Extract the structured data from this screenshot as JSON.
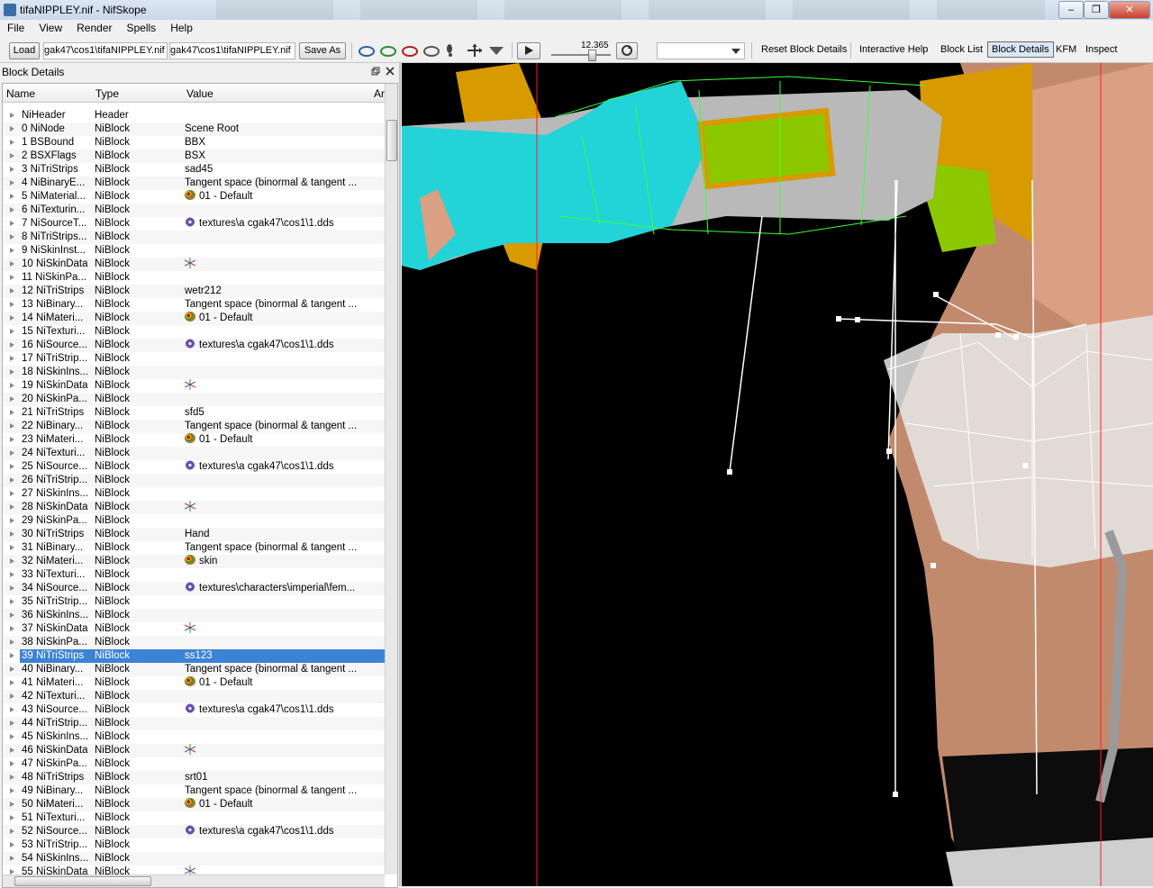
{
  "window": {
    "title": "tifaNIPPLEY.nif - NifSkope",
    "minimize": "–",
    "maximize": "❐",
    "close": "✕"
  },
  "menu": [
    "File",
    "View",
    "Render",
    "Spells",
    "Help"
  ],
  "toolbar": {
    "load_label": "Load",
    "load_path": "gak47\\cos1\\tifaNIPPLEY.nif",
    "save_path": "gak47\\cos1\\tifaNIPPLEY.nif",
    "save_as_label": "Save As",
    "time_value": "12.365",
    "reset_block_details": "Reset Block Details",
    "interactive_help": "Interactive Help",
    "block_list": "Block List",
    "block_details": "Block Details",
    "kfm": "KFM",
    "inspect": "Inspect"
  },
  "dock": {
    "title": "Block Details"
  },
  "table": {
    "headers": [
      "Name",
      "Type",
      "Value",
      "Ar"
    ],
    "rows": [
      {
        "name": "NiHeader",
        "type": "Header",
        "value": "",
        "icon": ""
      },
      {
        "name": "0 NiNode",
        "type": "NiBlock",
        "value": "Scene Root",
        "icon": ""
      },
      {
        "name": "1 BSBound",
        "type": "NiBlock",
        "value": "BBX",
        "icon": ""
      },
      {
        "name": "2 BSXFlags",
        "type": "NiBlock",
        "value": "BSX",
        "icon": ""
      },
      {
        "name": "3 NiTriStrips",
        "type": "NiBlock",
        "value": "sad45",
        "icon": ""
      },
      {
        "name": "4 NiBinaryE...",
        "type": "NiBlock",
        "value": "Tangent space (binormal & tangent ...",
        "icon": ""
      },
      {
        "name": "5 NiMaterial...",
        "type": "NiBlock",
        "value": "01 - Default",
        "icon": "palette"
      },
      {
        "name": "6 NiTexturin...",
        "type": "NiBlock",
        "value": "",
        "icon": ""
      },
      {
        "name": "7 NiSourceT...",
        "type": "NiBlock",
        "value": "textures\\a cgak47\\cos1\\1.dds",
        "icon": "tex"
      },
      {
        "name": "8 NiTriStrips...",
        "type": "NiBlock",
        "value": "",
        "icon": ""
      },
      {
        "name": "9 NiSkinInst...",
        "type": "NiBlock",
        "value": "",
        "icon": ""
      },
      {
        "name": "10 NiSkinData",
        "type": "NiBlock",
        "value": "",
        "icon": "skin"
      },
      {
        "name": "11 NiSkinPa...",
        "type": "NiBlock",
        "value": "",
        "icon": ""
      },
      {
        "name": "12 NiTriStrips",
        "type": "NiBlock",
        "value": "wetr212",
        "icon": ""
      },
      {
        "name": "13 NiBinary...",
        "type": "NiBlock",
        "value": "Tangent space (binormal & tangent ...",
        "icon": ""
      },
      {
        "name": "14 NiMateri...",
        "type": "NiBlock",
        "value": "01 - Default",
        "icon": "palette"
      },
      {
        "name": "15 NiTexturi...",
        "type": "NiBlock",
        "value": "",
        "icon": ""
      },
      {
        "name": "16 NiSource...",
        "type": "NiBlock",
        "value": "textures\\a cgak47\\cos1\\1.dds",
        "icon": "tex"
      },
      {
        "name": "17 NiTriStrip...",
        "type": "NiBlock",
        "value": "",
        "icon": ""
      },
      {
        "name": "18 NiSkinIns...",
        "type": "NiBlock",
        "value": "",
        "icon": ""
      },
      {
        "name": "19 NiSkinData",
        "type": "NiBlock",
        "value": "",
        "icon": "skin"
      },
      {
        "name": "20 NiSkinPa...",
        "type": "NiBlock",
        "value": "",
        "icon": ""
      },
      {
        "name": "21 NiTriStrips",
        "type": "NiBlock",
        "value": "sfd5",
        "icon": ""
      },
      {
        "name": "22 NiBinary...",
        "type": "NiBlock",
        "value": "Tangent space (binormal & tangent ...",
        "icon": ""
      },
      {
        "name": "23 NiMateri...",
        "type": "NiBlock",
        "value": "01 - Default",
        "icon": "palette"
      },
      {
        "name": "24 NiTexturi...",
        "type": "NiBlock",
        "value": "",
        "icon": ""
      },
      {
        "name": "25 NiSource...",
        "type": "NiBlock",
        "value": "textures\\a cgak47\\cos1\\1.dds",
        "icon": "tex"
      },
      {
        "name": "26 NiTriStrip...",
        "type": "NiBlock",
        "value": "",
        "icon": ""
      },
      {
        "name": "27 NiSkinIns...",
        "type": "NiBlock",
        "value": "",
        "icon": ""
      },
      {
        "name": "28 NiSkinData",
        "type": "NiBlock",
        "value": "",
        "icon": "skin"
      },
      {
        "name": "29 NiSkinPa...",
        "type": "NiBlock",
        "value": "",
        "icon": ""
      },
      {
        "name": "30 NiTriStrips",
        "type": "NiBlock",
        "value": "Hand",
        "icon": ""
      },
      {
        "name": "31 NiBinary...",
        "type": "NiBlock",
        "value": "Tangent space (binormal & tangent ...",
        "icon": ""
      },
      {
        "name": "32 NiMateri...",
        "type": "NiBlock",
        "value": "skin",
        "icon": "palette"
      },
      {
        "name": "33 NiTexturi...",
        "type": "NiBlock",
        "value": "",
        "icon": ""
      },
      {
        "name": "34 NiSource...",
        "type": "NiBlock",
        "value": "textures\\characters\\imperial\\fem...",
        "icon": "tex"
      },
      {
        "name": "35 NiTriStrip...",
        "type": "NiBlock",
        "value": "",
        "icon": ""
      },
      {
        "name": "36 NiSkinIns...",
        "type": "NiBlock",
        "value": "",
        "icon": ""
      },
      {
        "name": "37 NiSkinData",
        "type": "NiBlock",
        "value": "",
        "icon": "skin"
      },
      {
        "name": "38 NiSkinPa...",
        "type": "NiBlock",
        "value": "",
        "icon": ""
      },
      {
        "name": "39 NiTriStrips",
        "type": "NiBlock",
        "value": "ss123",
        "icon": "",
        "selected": true
      },
      {
        "name": "40 NiBinary...",
        "type": "NiBlock",
        "value": "Tangent space (binormal & tangent ...",
        "icon": ""
      },
      {
        "name": "41 NiMateri...",
        "type": "NiBlock",
        "value": "01 - Default",
        "icon": "palette"
      },
      {
        "name": "42 NiTexturi...",
        "type": "NiBlock",
        "value": "",
        "icon": ""
      },
      {
        "name": "43 NiSource...",
        "type": "NiBlock",
        "value": "textures\\a cgak47\\cos1\\1.dds",
        "icon": "tex"
      },
      {
        "name": "44 NiTriStrip...",
        "type": "NiBlock",
        "value": "",
        "icon": ""
      },
      {
        "name": "45 NiSkinIns...",
        "type": "NiBlock",
        "value": "",
        "icon": ""
      },
      {
        "name": "46 NiSkinData",
        "type": "NiBlock",
        "value": "",
        "icon": "skin"
      },
      {
        "name": "47 NiSkinPa...",
        "type": "NiBlock",
        "value": "",
        "icon": ""
      },
      {
        "name": "48 NiTriStrips",
        "type": "NiBlock",
        "value": "srt01",
        "icon": ""
      },
      {
        "name": "49 NiBinary...",
        "type": "NiBlock",
        "value": "Tangent space (binormal & tangent ...",
        "icon": ""
      },
      {
        "name": "50 NiMateri...",
        "type": "NiBlock",
        "value": "01 - Default",
        "icon": "palette"
      },
      {
        "name": "51 NiTexturi...",
        "type": "NiBlock",
        "value": "",
        "icon": ""
      },
      {
        "name": "52 NiSource...",
        "type": "NiBlock",
        "value": "textures\\a cgak47\\cos1\\1.dds",
        "icon": "tex"
      },
      {
        "name": "53 NiTriStrip...",
        "type": "NiBlock",
        "value": "",
        "icon": ""
      },
      {
        "name": "54 NiSkinIns...",
        "type": "NiBlock",
        "value": "",
        "icon": ""
      },
      {
        "name": "55 NiSkinData",
        "type": "NiBlock",
        "value": "",
        "icon": "skin"
      }
    ]
  },
  "colors": {
    "selection": "#3c83d6",
    "viewport_bg": "#000000",
    "armor_orange": "#d79a00",
    "armor_green": "#8cc800",
    "glove_cyan": "#22d3d8",
    "wire_green": "#3cff3c",
    "axis_red": "#ff2020"
  }
}
